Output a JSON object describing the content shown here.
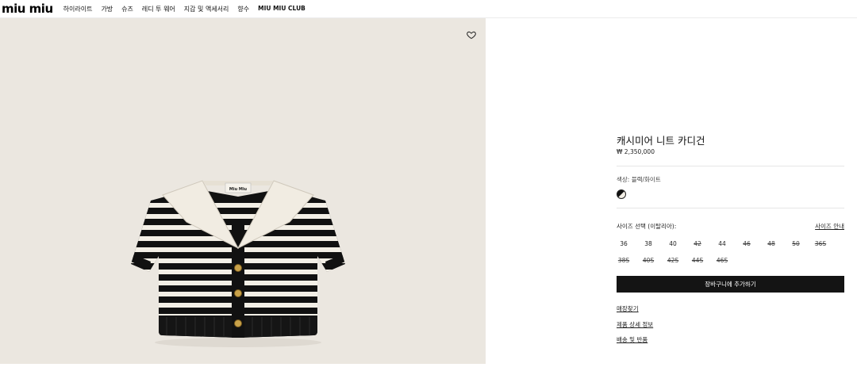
{
  "header": {
    "logo": "miu miu",
    "nav": [
      "하이라이트",
      "가방",
      "슈즈",
      "레디 투 웨어",
      "지갑 및 액세서리",
      "향수",
      "MIU MIU CLUB"
    ]
  },
  "gallery": {
    "wishlist_icon": "heart-outline-icon",
    "label_text": "Miu Miu"
  },
  "product": {
    "title": "캐시미어 니트 카디건",
    "price": "₩ 2,350,000",
    "color_label": "색상: 블랙/화이트",
    "size_label": "사이즈 선택 (이탈리아):",
    "size_guide": "사이즈 안내",
    "sizes_row1": [
      {
        "label": "36",
        "available": true
      },
      {
        "label": "38",
        "available": true
      },
      {
        "label": "40",
        "available": true
      },
      {
        "label": "42",
        "available": false
      },
      {
        "label": "44",
        "available": true
      },
      {
        "label": "46",
        "available": false
      },
      {
        "label": "48",
        "available": false
      },
      {
        "label": "50",
        "available": false
      },
      {
        "label": "36S",
        "available": false
      }
    ],
    "sizes_row2": [
      {
        "label": "38S",
        "available": false
      },
      {
        "label": "40S",
        "available": false
      },
      {
        "label": "42S",
        "available": false
      },
      {
        "label": "44S",
        "available": false
      },
      {
        "label": "46S",
        "available": false
      }
    ],
    "add_to_cart": "장바구니에 추가하기",
    "links": [
      "매장찾기",
      "제품 상세 정보",
      "배송 및 반품"
    ]
  },
  "colors": {
    "image_bg": "#ebe7e0",
    "button_bg": "#141414",
    "knit_black": "#111111",
    "knit_cream": "#f3efe6"
  }
}
